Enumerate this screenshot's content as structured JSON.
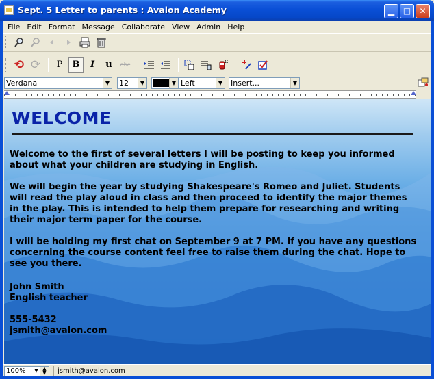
{
  "window": {
    "title": "Sept. 5 Letter to parents : Avalon Academy",
    "minimize_glyph": "▁",
    "maximize_glyph": "□",
    "close_glyph": "✕"
  },
  "menu": [
    "File",
    "Edit",
    "Format",
    "Message",
    "Collaborate",
    "View",
    "Admin",
    "Help"
  ],
  "toolbar1": {
    "icons": [
      "search-icon",
      "link-icon",
      "back-arrow-icon",
      "forward-arrow-icon",
      "print-icon",
      "delete-icon"
    ]
  },
  "toolbar2": {
    "undo_glyph": "⟲",
    "redo_glyph": "⟳",
    "plain_label": "P",
    "bold_label": "B",
    "italic_label": "I",
    "underline_label": "u",
    "strike_label": "abc",
    "icons": [
      "indent-icon",
      "outdent-icon",
      "insert-link-icon",
      "insert-table-icon",
      "spellcheck-icon",
      "add-file-icon",
      "checklist-icon"
    ]
  },
  "format": {
    "font": "Verdana",
    "size": "12",
    "color": "#000000",
    "align": "Left",
    "insert": "Insert..."
  },
  "document": {
    "heading": "WELCOME",
    "p1": [
      "Welcome to the first of several letters I will be posting to keep you informed",
      "about what your children are studying in English."
    ],
    "p2": [
      "We will begin the year by studying Shakespeare's Romeo and Juliet. Students",
      "will read the play aloud in class and then proceed to identify the major themes",
      "in the play. This is intended to help them prepare for researching and writing",
      "their major term paper for the course."
    ],
    "p3": [
      "I will be holding my first chat on September 9 at 7 PM. If you have any questions",
      "concerning the course content feel free to raise them during the chat. Hope to",
      "see you there."
    ],
    "signature": [
      "John Smith",
      "English teacher"
    ],
    "contact": [
      "555-5432",
      "jsmith@avalon.com"
    ]
  },
  "status": {
    "zoom": "100%",
    "email": "jsmith@avalon.com"
  },
  "colors": {
    "heading": "#0a23a8",
    "titlebar": "#0A4FD6"
  }
}
